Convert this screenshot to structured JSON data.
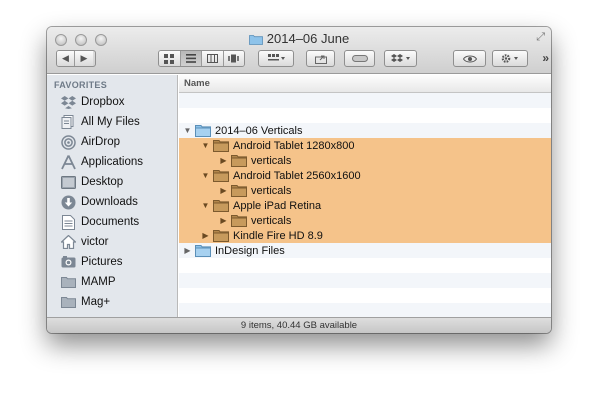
{
  "window": {
    "title": "2014–06 June",
    "status": "9 items, 40.44 GB available"
  },
  "toolbar": {
    "back_icon": "◀",
    "forward_icon": "▶",
    "views": [
      "icon-view",
      "list-view",
      "column-view",
      "coverflow-view"
    ],
    "active_view": "list-view",
    "arrange_icon": "arrange-grid-icon",
    "share_icon": "share-icon",
    "tag_icon": "tag-icon",
    "dropbox_icon": "dropbox-icon",
    "quicklook_icon": "eye-icon",
    "action_icon": "gear-icon",
    "overflow": "»"
  },
  "sidebar": {
    "header": "FAVORITES",
    "items": [
      {
        "label": "Dropbox",
        "icon": "dropbox-icon"
      },
      {
        "label": "All My Files",
        "icon": "all-files-icon"
      },
      {
        "label": "AirDrop",
        "icon": "airdrop-icon"
      },
      {
        "label": "Applications",
        "icon": "applications-icon"
      },
      {
        "label": "Desktop",
        "icon": "desktop-icon"
      },
      {
        "label": "Downloads",
        "icon": "downloads-icon"
      },
      {
        "label": "Documents",
        "icon": "documents-icon"
      },
      {
        "label": "victor",
        "icon": "home-icon"
      },
      {
        "label": "Pictures",
        "icon": "pictures-icon"
      },
      {
        "label": "MAMP",
        "icon": "folder-icon"
      },
      {
        "label": "Mag+",
        "icon": "folder-icon"
      }
    ]
  },
  "list": {
    "column_header": "Name",
    "rows": [
      {
        "name": "2014–06 Verticals",
        "indent": 0,
        "expanded": true,
        "selected": false
      },
      {
        "name": "Android Tablet 1280x800",
        "indent": 1,
        "expanded": true,
        "selected": true
      },
      {
        "name": "verticals",
        "indent": 2,
        "expanded": false,
        "selected": true
      },
      {
        "name": "Android Tablet 2560x1600",
        "indent": 1,
        "expanded": true,
        "selected": true
      },
      {
        "name": "verticals",
        "indent": 2,
        "expanded": false,
        "selected": true
      },
      {
        "name": "Apple iPad Retina",
        "indent": 1,
        "expanded": true,
        "selected": true
      },
      {
        "name": "verticals",
        "indent": 2,
        "expanded": false,
        "selected": true
      },
      {
        "name": "Kindle Fire HD 8.9",
        "indent": 1,
        "expanded": false,
        "selected": true
      },
      {
        "name": "InDesign Files",
        "indent": 0,
        "expanded": false,
        "selected": false
      }
    ]
  },
  "colors": {
    "selection": "#f5c38a",
    "folder_blue": "#8ec3ea",
    "folder_tan": "#b3874b",
    "sidebar_bg": "#e3e7ec"
  }
}
